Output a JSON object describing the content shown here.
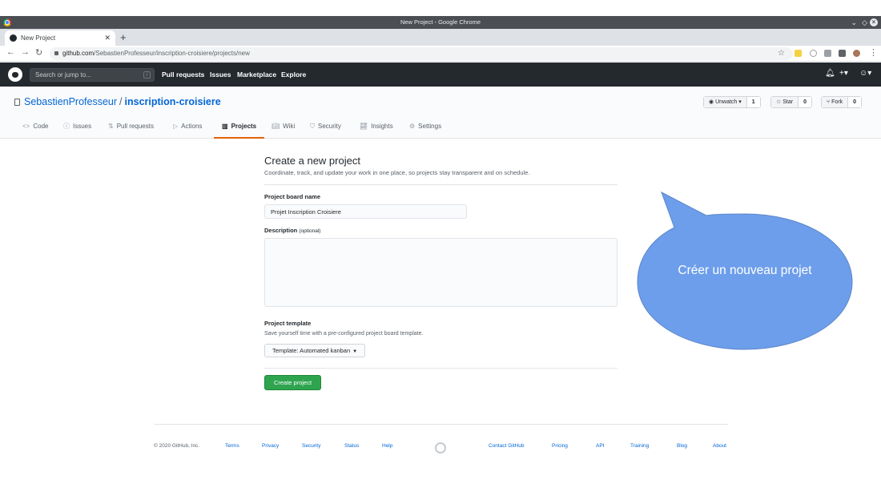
{
  "browser": {
    "window_title": "New Project - Google Chrome",
    "tab_title": "New Project",
    "url_host": "github.com",
    "url_path": "/SebastienProfesseur/inscription-croisiere/projects/new"
  },
  "header": {
    "search_placeholder": "Search or jump to...",
    "search_key": "/",
    "nav": [
      "Pull requests",
      "Issues",
      "Marketplace",
      "Explore"
    ]
  },
  "repo": {
    "owner": "SebastienProfesseur",
    "separator": "/",
    "name": "inscription-croisiere",
    "unwatch_label": "Unwatch",
    "unwatch_count": "1",
    "star_label": "Star",
    "star_count": "0",
    "fork_label": "Fork",
    "fork_count": "0",
    "tabs": [
      "Code",
      "Issues",
      "Pull requests",
      "Actions",
      "Projects",
      "Wiki",
      "Security",
      "Insights",
      "Settings"
    ],
    "selected_tab": "Projects"
  },
  "form": {
    "title": "Create a new project",
    "subtitle": "Coordinate, track, and update your work in one place, so projects stay transparent and on schedule.",
    "name_label": "Project board name",
    "name_value": "Projet Inscription Croisiere",
    "desc_label": "Description",
    "desc_optional": "(optional)",
    "template_label": "Project template",
    "template_hint": "Save yourself time with a pre-configured project board template.",
    "template_button": "Template: Automated kanban",
    "create_button": "Create project"
  },
  "footer": {
    "copyright": "© 2020 GitHub, Inc.",
    "left_links": [
      "Terms",
      "Privacy",
      "Security",
      "Status",
      "Help"
    ],
    "right_links": [
      "Contact GitHub",
      "Pricing",
      "API",
      "Training",
      "Blog",
      "About"
    ]
  },
  "callout": {
    "text": "Créer un nouveau projet",
    "color": "#6d9eeb"
  }
}
